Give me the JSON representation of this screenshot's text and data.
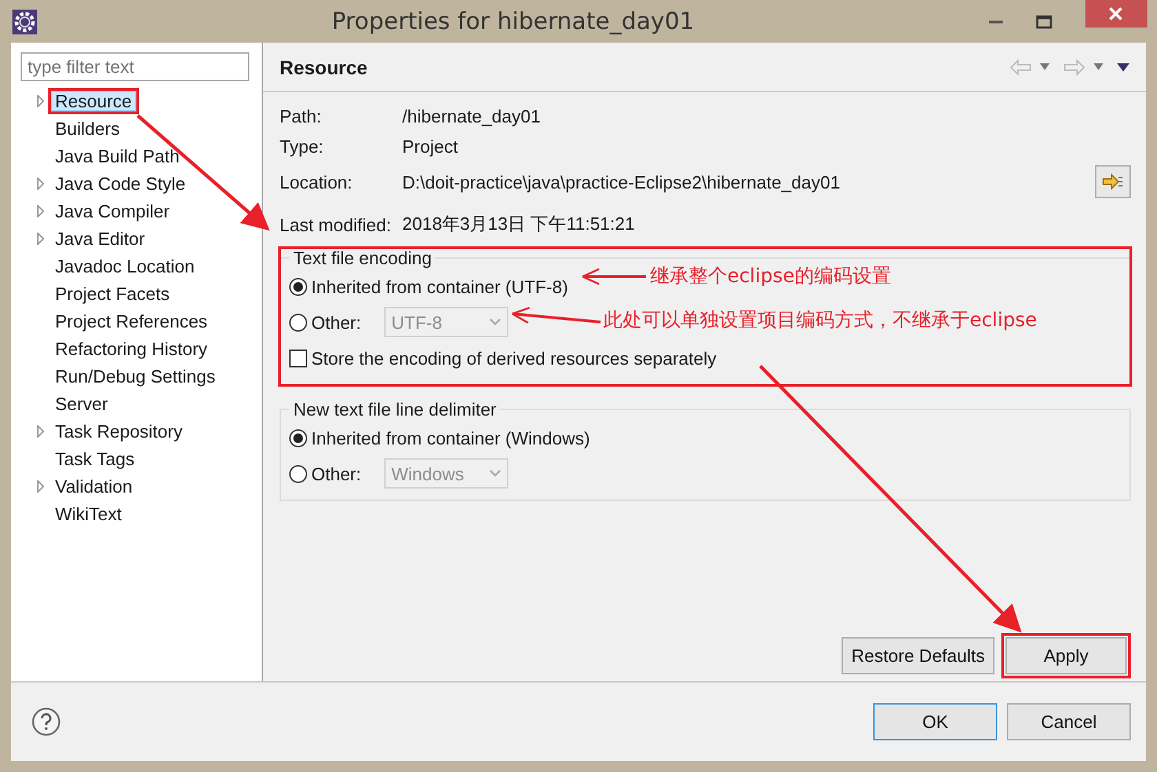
{
  "window": {
    "title": "Properties for hibernate_day01"
  },
  "filter": {
    "placeholder": "type filter text"
  },
  "tree": [
    {
      "label": "Resource",
      "expandable": true,
      "selected": true,
      "highlighted": true
    },
    {
      "label": "Builders",
      "expandable": false,
      "selected": false,
      "highlighted": false
    },
    {
      "label": "Java Build Path",
      "expandable": false,
      "selected": false,
      "highlighted": false
    },
    {
      "label": "Java Code Style",
      "expandable": true,
      "selected": false,
      "highlighted": false
    },
    {
      "label": "Java Compiler",
      "expandable": true,
      "selected": false,
      "highlighted": false
    },
    {
      "label": "Java Editor",
      "expandable": true,
      "selected": false,
      "highlighted": false
    },
    {
      "label": "Javadoc Location",
      "expandable": false,
      "selected": false,
      "highlighted": false
    },
    {
      "label": "Project Facets",
      "expandable": false,
      "selected": false,
      "highlighted": false
    },
    {
      "label": "Project References",
      "expandable": false,
      "selected": false,
      "highlighted": false
    },
    {
      "label": "Refactoring History",
      "expandable": false,
      "selected": false,
      "highlighted": false
    },
    {
      "label": "Run/Debug Settings",
      "expandable": false,
      "selected": false,
      "highlighted": false
    },
    {
      "label": "Server",
      "expandable": false,
      "selected": false,
      "highlighted": false
    },
    {
      "label": "Task Repository",
      "expandable": true,
      "selected": false,
      "highlighted": false
    },
    {
      "label": "Task Tags",
      "expandable": false,
      "selected": false,
      "highlighted": false
    },
    {
      "label": "Validation",
      "expandable": true,
      "selected": false,
      "highlighted": false
    },
    {
      "label": "WikiText",
      "expandable": false,
      "selected": false,
      "highlighted": false
    }
  ],
  "page": {
    "title": "Resource",
    "info": [
      {
        "label": "Path:",
        "value": "/hibernate_day01",
        "has_button": false
      },
      {
        "label": "Type:",
        "value": "Project",
        "has_button": false
      },
      {
        "label": "Location:",
        "value": "D:\\doit-practice\\java\\practice-Eclipse2\\hibernate_day01",
        "has_button": true
      },
      {
        "label": "Last modified:",
        "value": "2018年3月13日 下午11:51:21",
        "has_button": false
      }
    ],
    "groups": [
      {
        "title": "Text file encoding",
        "highlighted": true,
        "options": [
          {
            "kind": "radio",
            "label": "Inherited from container (UTF-8)",
            "selected": true
          },
          {
            "kind": "radio-combo",
            "label": "Other:",
            "selected": false,
            "combo_value": "UTF-8",
            "disabled": true
          },
          {
            "kind": "checkbox",
            "label": "Store the encoding of derived resources separately",
            "checked": false
          }
        ]
      },
      {
        "title": "New text file line delimiter",
        "highlighted": false,
        "options": [
          {
            "kind": "radio",
            "label": "Inherited from container (Windows)",
            "selected": true
          },
          {
            "kind": "radio-combo",
            "label": "Other:",
            "selected": false,
            "combo_value": "Windows",
            "disabled": true
          }
        ]
      }
    ],
    "buttons": [
      {
        "label": "Restore Defaults",
        "highlighted": false
      },
      {
        "label": "Apply",
        "highlighted": true
      }
    ]
  },
  "footer_buttons": [
    {
      "label": "OK",
      "default": true
    },
    {
      "label": "Cancel",
      "default": false
    }
  ],
  "notes": [
    "继承整个eclipse的编码设置",
    "此处可以单独设置项目编码方式，不继承于eclipse"
  ]
}
